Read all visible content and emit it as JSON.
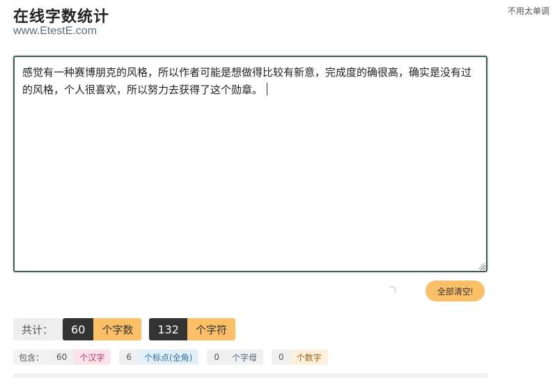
{
  "header": {
    "title": "在线字数统计",
    "site_url": "www.EtestE.com",
    "corner_link": "不用太单调"
  },
  "editor": {
    "value": "感觉有一种赛博朋克的风格，所以作者可能是想做得比较有新意，完成度的确很高，确实是没有过的风格，个人很喜欢，所以努力去获得了这个勋章。"
  },
  "actions": {
    "clear_label": "全部清空!"
  },
  "totals": {
    "label": "共计：",
    "char_count": "60",
    "char_unit": "个字数",
    "symbol_count": "132",
    "symbol_unit": "个字符"
  },
  "breakdown": {
    "label": "包含：",
    "hanzi_count": "60",
    "hanzi_unit": "个汉字",
    "punct_count": "6",
    "punct_unit": "个标点(全角)",
    "letter_count": "0",
    "letter_unit": "个字母",
    "digit_count": "0",
    "digit_unit": "个数字"
  },
  "colors": {
    "accent": "#fbbf67",
    "dark": "#333333",
    "editor_border": "#3f5e5a"
  }
}
